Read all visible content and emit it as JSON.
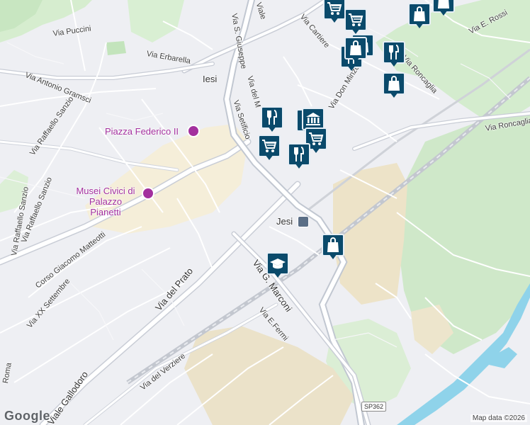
{
  "map": {
    "city_label": "Iesi",
    "streets": {
      "via_puccini": "Via Puccini",
      "via_erbarella": "Via Erbarella",
      "via_antonio_gramsci": "Via Antonio Gramsci",
      "via_raffaello_sanzio_1": "Via Raffaello Sanzio",
      "via_raffaello_sanzio_2": "Via Raffaello Sanzio",
      "via_raffaello_sanzio_3": "Via Raffaello Sanzio",
      "via_s_giuseppe": "Via S. Giuseppe",
      "viale_top": "Viale",
      "via_del_m": "Via del M",
      "via_setificio": "Via Setificio",
      "via_cartiere": "Via Cartiere",
      "via_don_minzoni": "Via Don Minzoni",
      "via_roncaglia_1": "Via Roncaglia",
      "via_roncaglia_2": "Via Roncaglia",
      "via_e_rossi": "Via E. Rossi",
      "corso_matteotti": "Corso Giacomo Matteotti",
      "via_del_prato": "Via del Prato",
      "via_xx_settembre": "Via XX Settembre",
      "via_g_marconi": "Via G. Marconi",
      "via_e_fermi": "Via E.Fermi",
      "via_del_verziere": "Via del Verziere",
      "viale_gallodoro": "Viale Gallodoro",
      "roma": "Roma"
    },
    "poi": {
      "piazza_federico": "Piazza Federico II",
      "musei_civici": "Musei Civici di Palazzo Pianetti"
    },
    "station_label": "Jesi",
    "route_shield": "SP362",
    "attribution": "Map data ©2026",
    "logo": "Google"
  },
  "markers": [
    {
      "icon": "cart",
      "label": "supermarket"
    },
    {
      "icon": "cart",
      "label": "supermarket"
    },
    {
      "icon": "bag",
      "label": "shop"
    },
    {
      "icon": "bag",
      "label": "shop"
    },
    {
      "icon": "bag",
      "label": "shop"
    },
    {
      "icon": "cutlery",
      "label": "restaurant"
    },
    {
      "icon": "cutlery",
      "label": "restaurant"
    },
    {
      "icon": "bag",
      "label": "shop"
    },
    {
      "icon": "bag",
      "label": "shop"
    },
    {
      "icon": "cutlery",
      "label": "restaurant"
    },
    {
      "icon": "cutlery",
      "label": "restaurant"
    },
    {
      "icon": "bank",
      "label": "bank"
    },
    {
      "icon": "cart",
      "label": "supermarket"
    },
    {
      "icon": "cart",
      "label": "supermarket"
    },
    {
      "icon": "cutlery",
      "label": "restaurant"
    },
    {
      "icon": "bag",
      "label": "shop"
    },
    {
      "icon": "school",
      "label": "school"
    }
  ]
}
